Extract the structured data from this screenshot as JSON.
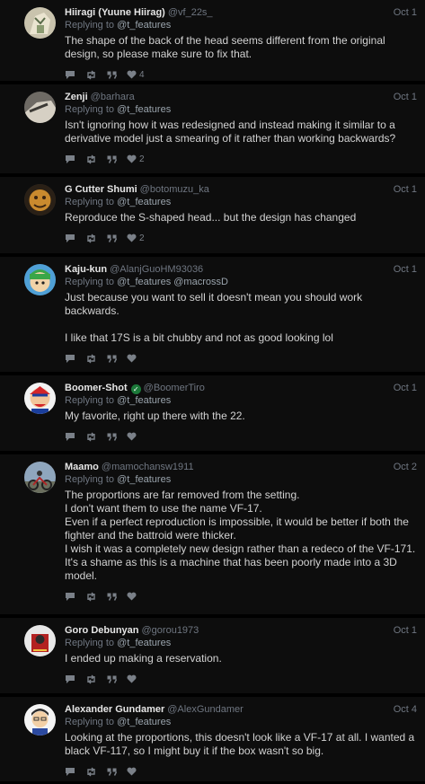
{
  "tweets": [
    {
      "name": "Hiiragi (Yuune Hiirag)",
      "handle": "@vf_22s_",
      "date": "Oct 1",
      "replying_prefix": "Replying to",
      "mentions": "@t_features",
      "text": "The shape of the back of the head seems different from the original design, so please make sure to fix that.",
      "likes": "4"
    },
    {
      "name": "Zenji",
      "handle": "@barhara",
      "date": "Oct 1",
      "replying_prefix": "Replying to",
      "mentions": "@t_features",
      "text": "Isn't ignoring how it was redesigned and instead making it similar to a derivative model just a smearing of it rather than working backwards?",
      "likes": "2"
    },
    {
      "name": "G Cutter Shumi",
      "handle": "@botomuzu_ka",
      "date": "Oct 1",
      "replying_prefix": "Replying to",
      "mentions": "@t_features",
      "text": "Reproduce the S-shaped head... but the design has changed",
      "likes": "2"
    },
    {
      "name": "Kaju-kun",
      "handle": "@AlanjGuoHM93036",
      "date": "Oct 1",
      "replying_prefix": "Replying to",
      "mentions": "@t_features @macrossD",
      "text": "Just because you want to sell it doesn't mean you should work backwards.\n\nI like that 17S is a bit chubby and not as good looking lol",
      "likes": ""
    },
    {
      "name": "Boomer-Shot",
      "handle": "@BoomerTiro",
      "date": "Oct 1",
      "replying_prefix": "Replying to",
      "mentions": "@t_features",
      "text": "My favorite, right up there with the 22.",
      "likes": "",
      "verified": "✓"
    },
    {
      "name": "Maamo",
      "handle": "@mamochansw1911",
      "date": "Oct 2",
      "replying_prefix": "Replying to",
      "mentions": "@t_features",
      "text": "The proportions are far removed from the setting.\nI don't want them to use the name VF-17.\nEven if a perfect reproduction is impossible, it would be better if both the fighter and the battroid were thicker.\nI wish it was a completely new design rather than a redeco of the VF-171. It's a shame as this is a machine that has been poorly made into a 3D model.",
      "likes": ""
    },
    {
      "name": "Goro Debunyan",
      "handle": "@gorou1973",
      "date": "Oct 1",
      "replying_prefix": "Replying to",
      "mentions": "@t_features",
      "text": "I ended up making a reservation.",
      "likes": ""
    },
    {
      "name": "Alexander Gundamer",
      "handle": "@AlexGundamer",
      "date": "Oct 4",
      "replying_prefix": "Replying to",
      "mentions": "@t_features",
      "text": "Looking at the proportions, this doesn't look like a VF-17 at all. I wanted a black VF-117, so I might buy it if the box wasn't so big.",
      "likes": ""
    }
  ]
}
